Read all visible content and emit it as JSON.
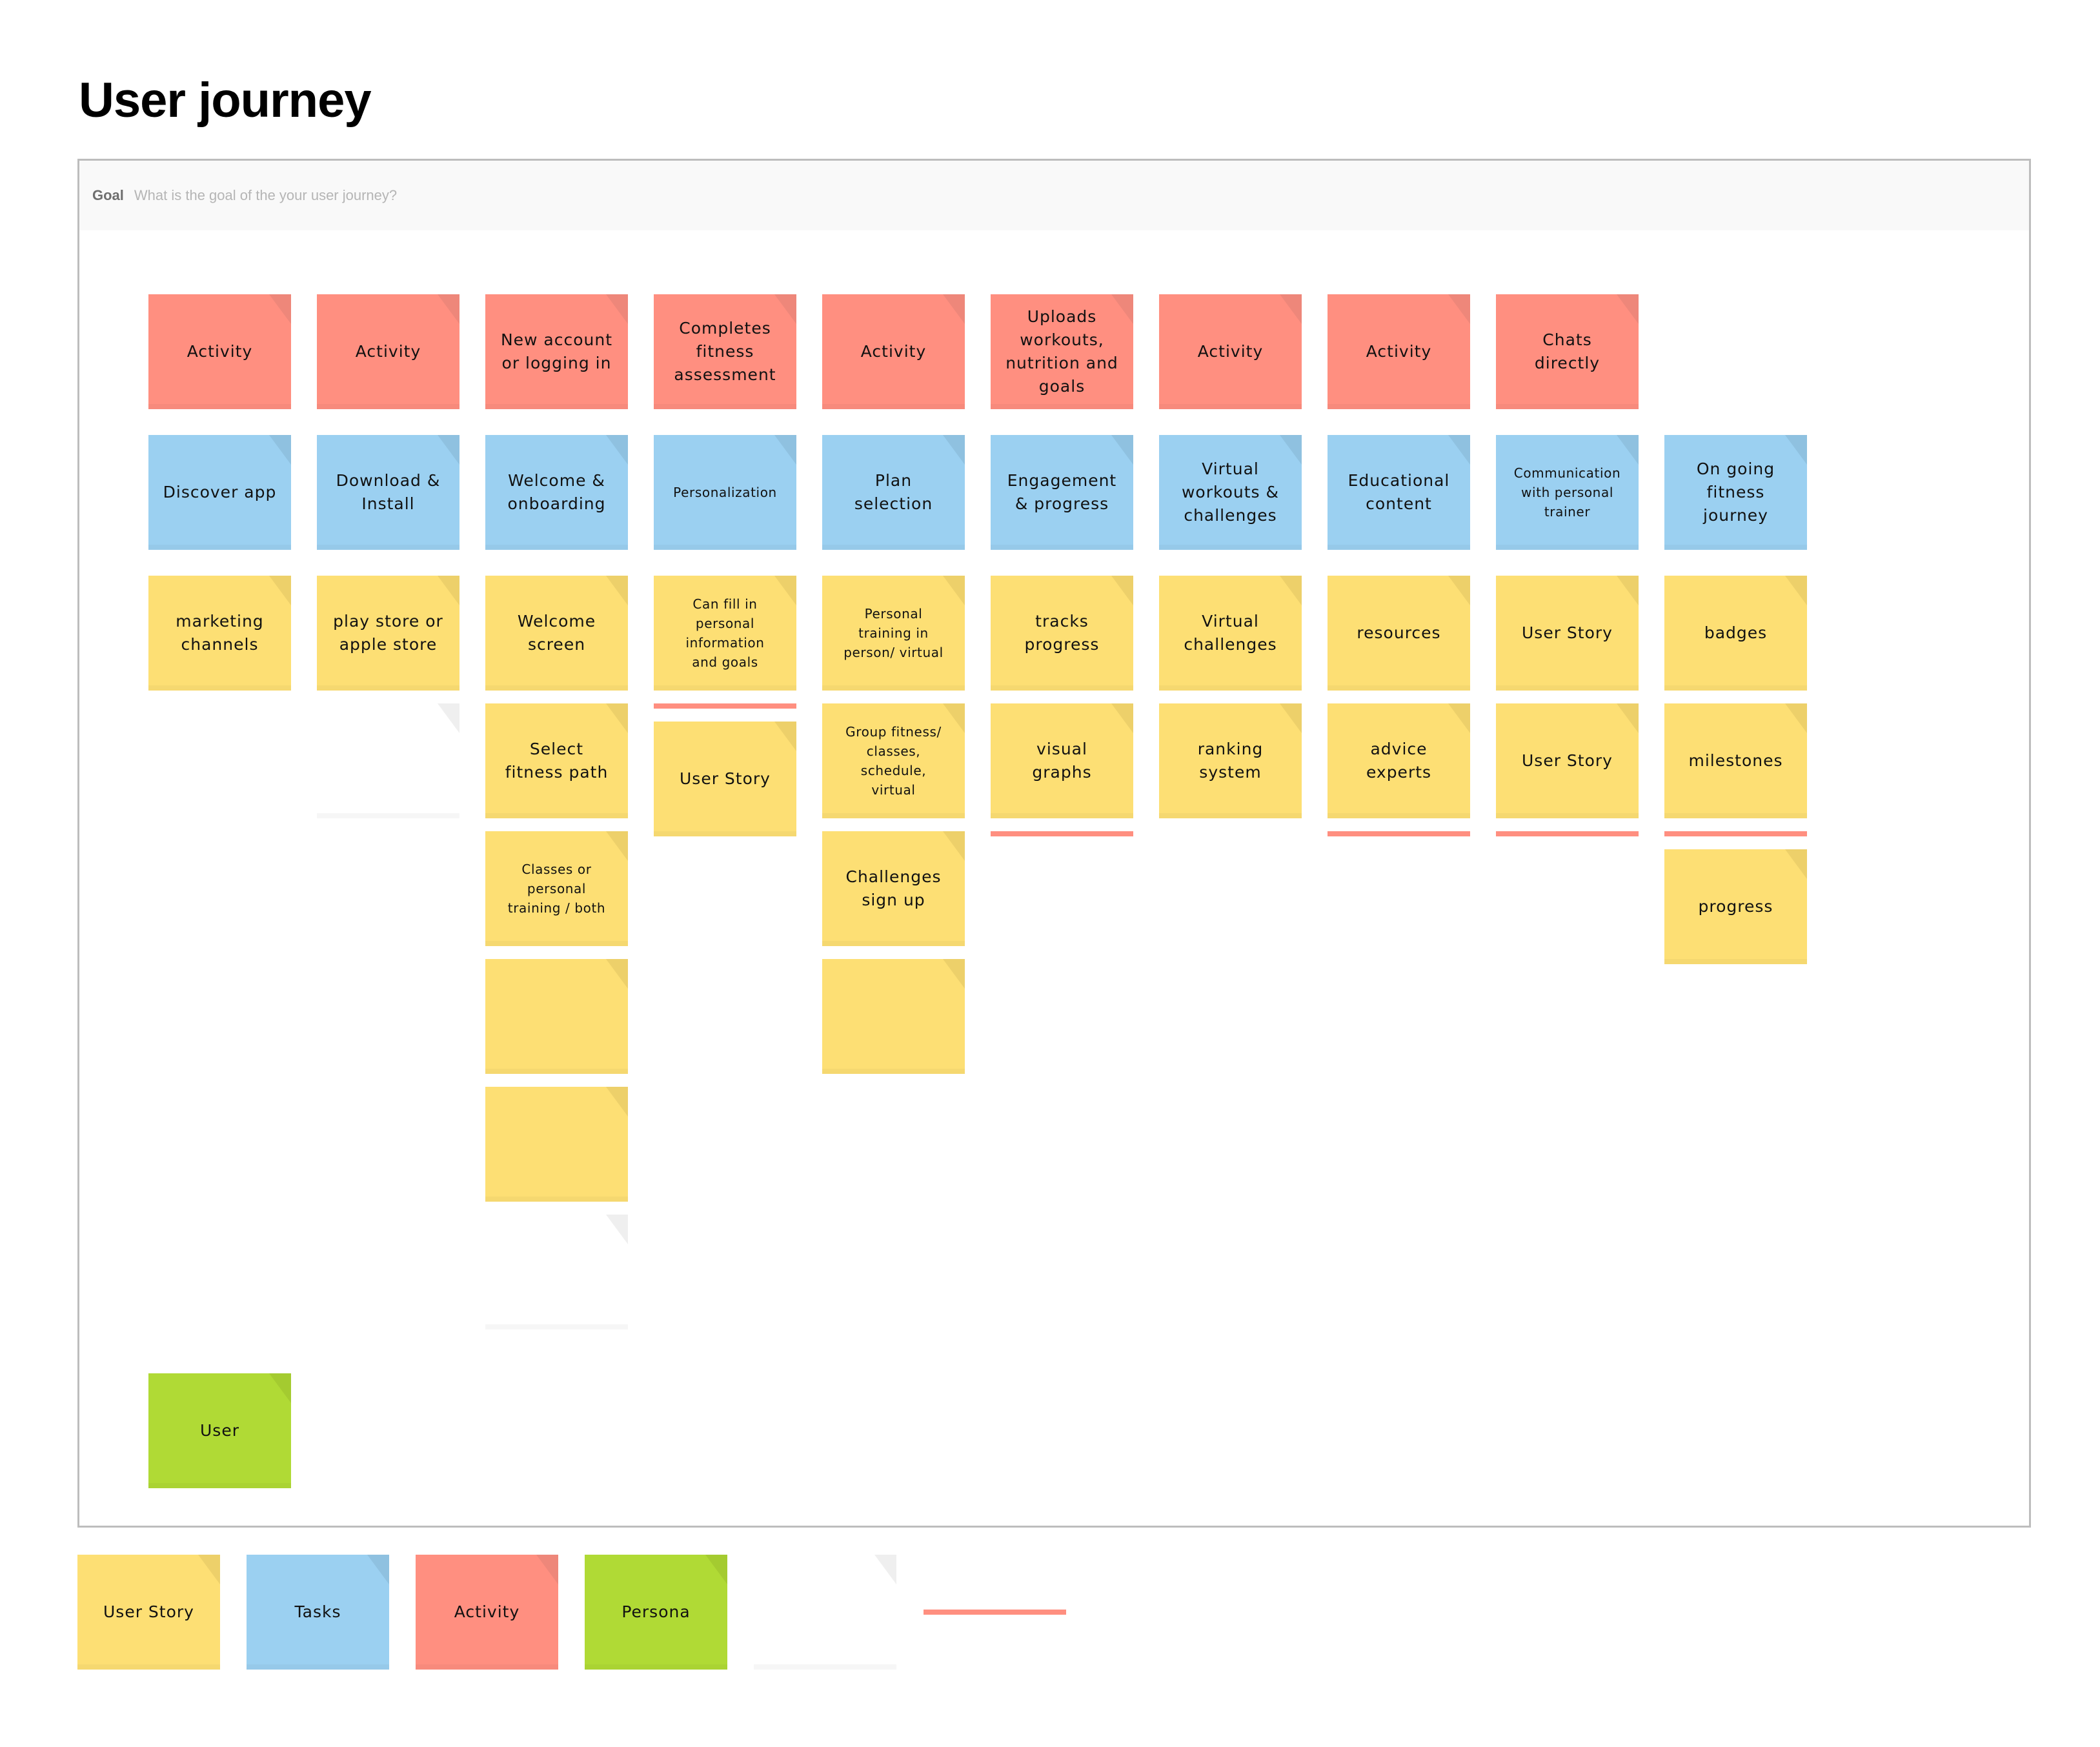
{
  "header": {
    "title": "User journey"
  },
  "goal": {
    "label": "Goal",
    "placeholder": "What is the goal of the your user journey?",
    "value": ""
  },
  "colors": {
    "user_story": "#fddf74",
    "task": "#9bd0f1",
    "activity": "#ff8f80",
    "persona": "#b0da35",
    "divider": "#ff8f80",
    "frame_border": "#bdbdbd"
  },
  "columns": [
    {
      "activity": "Activity",
      "task": "Discover app",
      "stack": [
        {
          "type": "story",
          "text": "marketing\nchannels"
        }
      ]
    },
    {
      "activity": "Activity",
      "task": "Download &\nInstall",
      "stack": [
        {
          "type": "story",
          "text": "play store or\napple store"
        },
        {
          "type": "blank",
          "text": ""
        }
      ]
    },
    {
      "activity": "New account\nor logging in",
      "task": "Welcome &\nonboarding",
      "stack": [
        {
          "type": "story",
          "text": "Welcome\nscreen"
        },
        {
          "type": "story",
          "text": "Select\nfitness path"
        },
        {
          "type": "story",
          "text": "Classes or\npersonal\ntraining / both",
          "small": true
        },
        {
          "type": "story",
          "text": ""
        },
        {
          "type": "story",
          "text": ""
        },
        {
          "type": "blank",
          "text": ""
        }
      ]
    },
    {
      "activity": "Completes\nfitness\nassessment",
      "task": "Personalization",
      "task_small": true,
      "stack": [
        {
          "type": "story",
          "text": "Can fill in\npersonal\ninformation\nand goals",
          "small": true
        },
        {
          "type": "divider"
        },
        {
          "type": "story",
          "text": "User Story"
        }
      ]
    },
    {
      "activity": "Activity",
      "task": "Plan\nselection",
      "stack": [
        {
          "type": "story",
          "text": "Personal\ntraining in\nperson/ virtual",
          "small": true
        },
        {
          "type": "story",
          "text": "Group fitness/\nclasses,\nschedule,\nvirtual",
          "small": true
        },
        {
          "type": "story",
          "text": "Challenges\nsign up"
        },
        {
          "type": "story",
          "text": ""
        }
      ]
    },
    {
      "activity": "Uploads\nworkouts,\nnutrition and\ngoals",
      "task": "Engagement\n& progress",
      "stack": [
        {
          "type": "story",
          "text": "tracks\nprogress"
        },
        {
          "type": "story",
          "text": "visual\ngraphs"
        },
        {
          "type": "divider"
        }
      ]
    },
    {
      "activity": "Activity",
      "task": "Virtual\nworkouts &\nchallenges",
      "stack": [
        {
          "type": "story",
          "text": "Virtual\nchallenges"
        },
        {
          "type": "story",
          "text": "ranking\nsystem"
        }
      ]
    },
    {
      "activity": "Activity",
      "task": "Educational\ncontent",
      "stack": [
        {
          "type": "story",
          "text": "resources"
        },
        {
          "type": "story",
          "text": "advice\nexperts"
        },
        {
          "type": "divider"
        }
      ]
    },
    {
      "activity": "Chats\ndirectly",
      "task": "Communication\nwith personal\ntrainer",
      "task_small": true,
      "stack": [
        {
          "type": "story",
          "text": "User Story"
        },
        {
          "type": "story",
          "text": "User Story"
        },
        {
          "type": "divider"
        }
      ]
    },
    {
      "activity": null,
      "task": "On going\nfitness\njourney",
      "stack": [
        {
          "type": "story",
          "text": "badges"
        },
        {
          "type": "story",
          "text": "milestones"
        },
        {
          "type": "divider"
        },
        {
          "type": "story",
          "text": "progress"
        }
      ]
    }
  ],
  "persona": {
    "label": "User"
  },
  "legend": [
    {
      "kind": "user_story",
      "label": "User Story"
    },
    {
      "kind": "task",
      "label": "Tasks"
    },
    {
      "kind": "activity",
      "label": "Activity"
    },
    {
      "kind": "persona",
      "label": "Persona"
    },
    {
      "kind": "blank",
      "label": ""
    },
    {
      "kind": "divider",
      "label": ""
    }
  ]
}
